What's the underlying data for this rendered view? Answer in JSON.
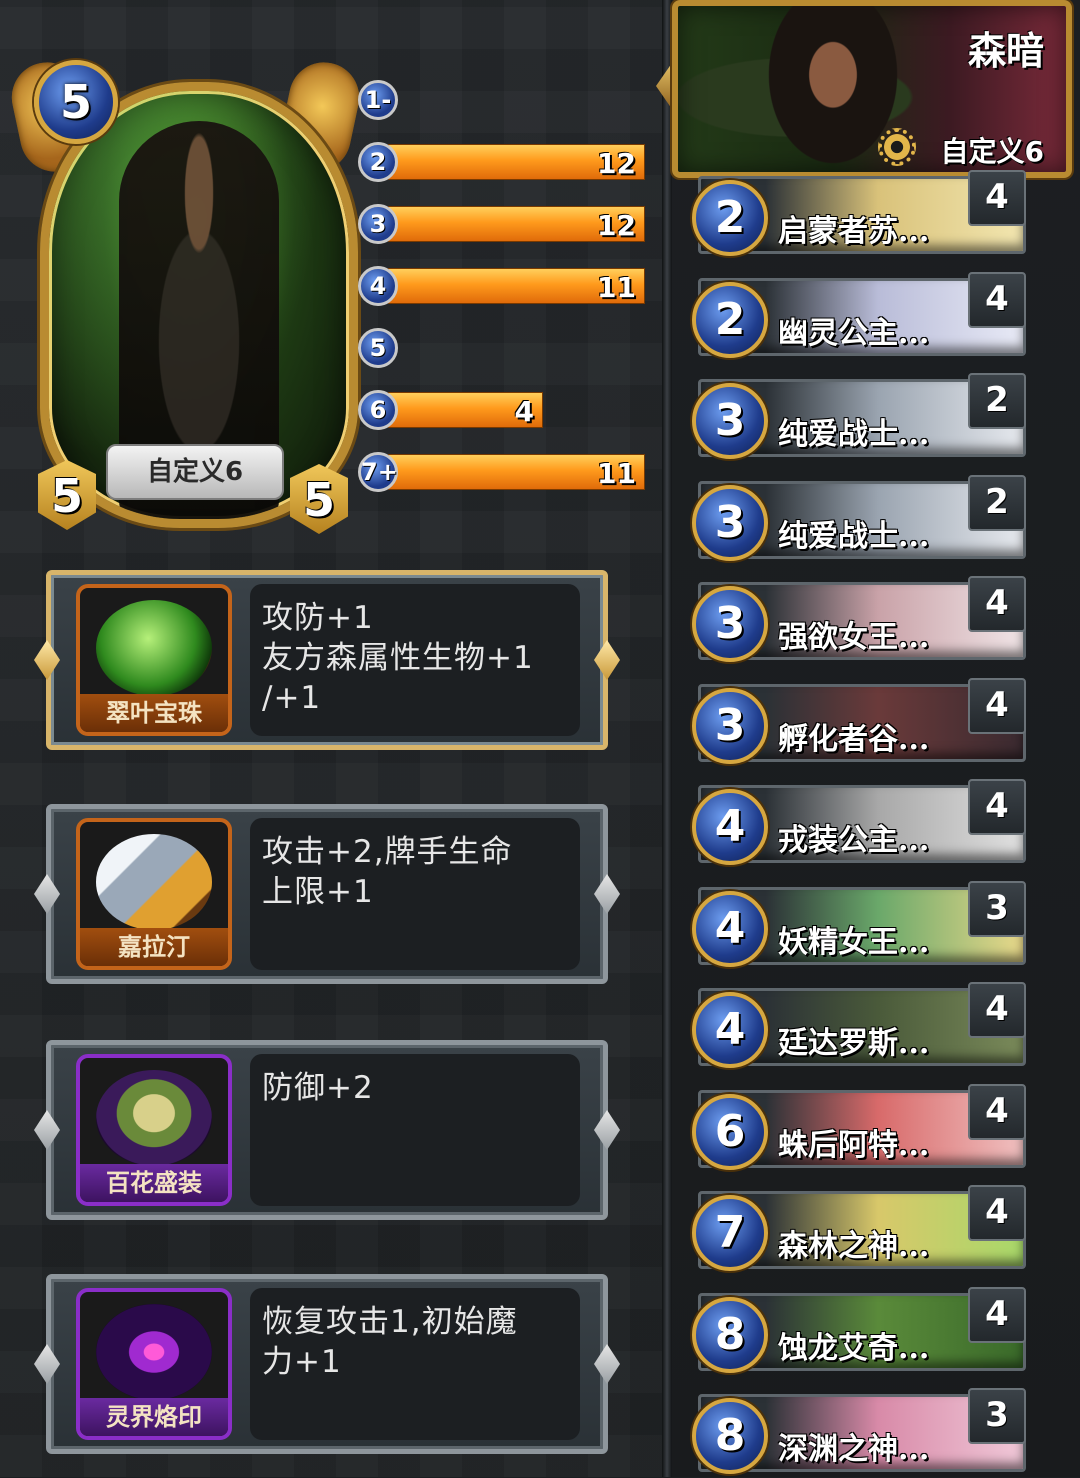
{
  "hero": {
    "cost": "5",
    "attack": "5",
    "health": "5",
    "name": "自定义6"
  },
  "curve": [
    {
      "label": "1-",
      "value": "",
      "fill": 0
    },
    {
      "label": "2",
      "value": "12",
      "fill": 1.0
    },
    {
      "label": "3",
      "value": "12",
      "fill": 1.0
    },
    {
      "label": "4",
      "value": "11",
      "fill": 1.0
    },
    {
      "label": "5",
      "value": "",
      "fill": 0
    },
    {
      "label": "6",
      "value": "4",
      "fill": 0.6
    },
    {
      "label": "7+",
      "value": "11",
      "fill": 1.0
    }
  ],
  "talents": [
    {
      "name": "翠叶宝珠",
      "desc": "攻防+1\n友方森属性生物+1\n/+1",
      "icon": "green-orb-icon",
      "rarity": "gold"
    },
    {
      "name": "嘉拉汀",
      "desc": "攻击+2,牌手生命\n上限+1",
      "icon": "sword-icon",
      "rarity": "orange"
    },
    {
      "name": "百花盛装",
      "desc": "防御+2",
      "icon": "dress-icon",
      "rarity": "purple"
    },
    {
      "name": "灵界烙印",
      "desc": "恢复攻击1,初始魔\n力+1",
      "icon": "rune-icon",
      "rarity": "purple"
    }
  ],
  "deck": {
    "name": "森暗",
    "subtitle": "自定义6",
    "cards": [
      {
        "cost": "2",
        "name": "启蒙者苏...",
        "count": "4",
        "c1": "#d9c27a",
        "c2": "#f2e6b0"
      },
      {
        "cost": "2",
        "name": "幽灵公主...",
        "count": "4",
        "c1": "#b9bcd8",
        "c2": "#e8eaf6"
      },
      {
        "cost": "3",
        "name": "纯爱战士...",
        "count": "2",
        "c1": "#9aa4b0",
        "c2": "#e6e9ee"
      },
      {
        "cost": "3",
        "name": "纯爱战士...",
        "count": "2",
        "c1": "#9aa4b0",
        "c2": "#e6e9ee"
      },
      {
        "cost": "3",
        "name": "强欲女王...",
        "count": "4",
        "c1": "#c9a2a8",
        "c2": "#f0e4e6"
      },
      {
        "cost": "3",
        "name": "孵化者谷...",
        "count": "4",
        "c1": "#6a3a3a",
        "c2": "#3a2a30"
      },
      {
        "cost": "4",
        "name": "戎装公主...",
        "count": "4",
        "c1": "#a8a8a8",
        "c2": "#e0e0e0"
      },
      {
        "cost": "4",
        "name": "妖精女王...",
        "count": "3",
        "c1": "#6aa86a",
        "c2": "#e8d88a"
      },
      {
        "cost": "4",
        "name": "廷达罗斯...",
        "count": "4",
        "c1": "#4a5a3a",
        "c2": "#7a8a5a"
      },
      {
        "cost": "6",
        "name": "蛛后阿特...",
        "count": "4",
        "c1": "#d86a6a",
        "c2": "#f0c0c0"
      },
      {
        "cost": "7",
        "name": "森林之神...",
        "count": "4",
        "c1": "#d8c86a",
        "c2": "#a8d86a"
      },
      {
        "cost": "8",
        "name": "蚀龙艾奇...",
        "count": "4",
        "c1": "#5a8a3a",
        "c2": "#3a6a2a"
      },
      {
        "cost": "8",
        "name": "深渊之神...",
        "count": "3",
        "c1": "#d88aa8",
        "c2": "#f0c8d8"
      }
    ]
  },
  "colors": {
    "bar_orange": "#ff9a1c",
    "gem_blue": "#1f3c8c",
    "gold_frame": "#b98b31"
  }
}
